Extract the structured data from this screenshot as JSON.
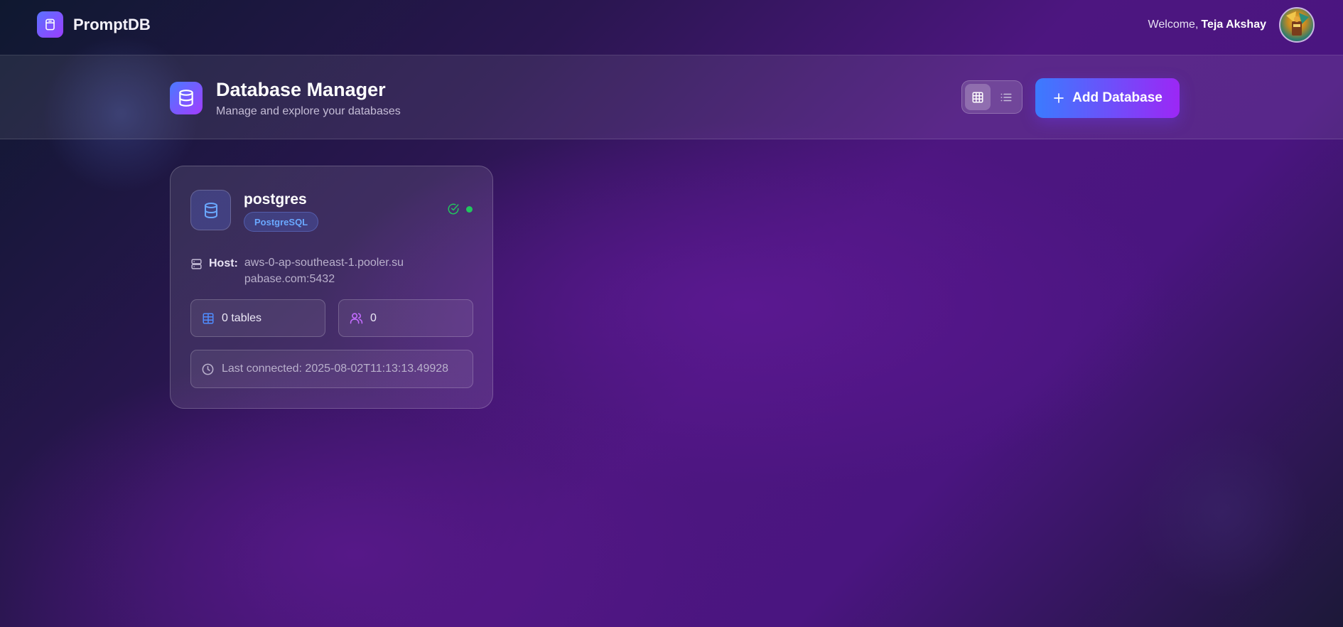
{
  "app": {
    "name": "PromptDB",
    "welcome_prefix": "Welcome,",
    "user_name": "Teja Akshay"
  },
  "header": {
    "title": "Database Manager",
    "subtitle": "Manage and explore your databases",
    "add_button_label": "Add Database",
    "view_mode": "grid"
  },
  "databases": [
    {
      "name": "postgres",
      "type": "PostgreSQL",
      "status": "connected",
      "host_label": "Host:",
      "host": "aws-0-ap-southeast-1.pooler.supabase.com:5432",
      "tables": "0 tables",
      "users": "0",
      "last_connected": "Last connected: 2025-08-02T11:13:13.49928"
    }
  ],
  "colors": {
    "accent_blue": "#3b7bff",
    "accent_purple": "#9c27f5",
    "status_green": "#22c55e",
    "badge_text": "#6aa8ff"
  },
  "icons": {
    "brand": "archive-box-icon",
    "header": "database-icon",
    "grid": "grid-icon",
    "list": "list-icon",
    "add": "plus-icon",
    "status": "check-circle-icon",
    "host": "server-icon",
    "tables": "table-icon",
    "users": "users-icon",
    "time": "clock-icon"
  }
}
